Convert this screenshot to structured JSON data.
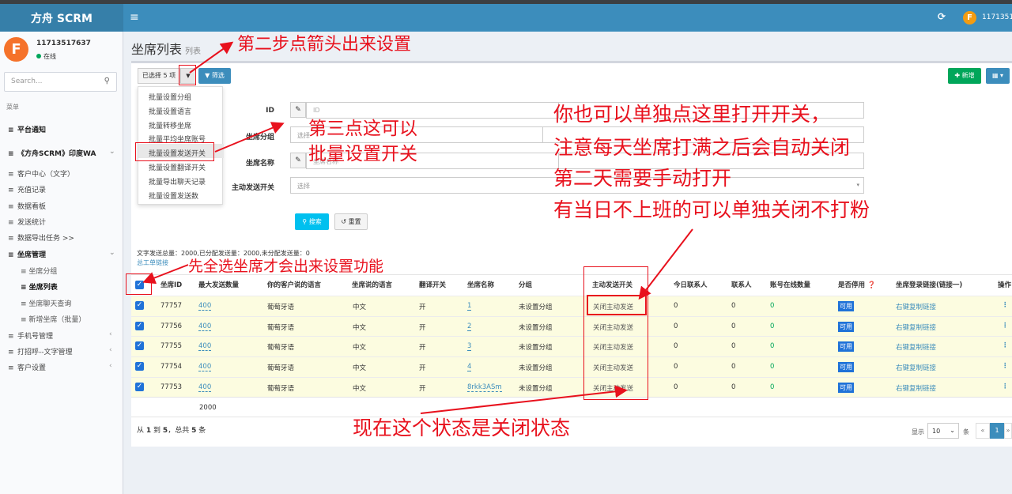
{
  "app": {
    "title": "方舟 SCRM",
    "menu_icon": "hamburger-icon",
    "refresh_icon": "refresh-icon",
    "user_avatar_letter": "F",
    "top_user": "11713517"
  },
  "user": {
    "name": "11713517637",
    "status": "在线",
    "avatar_letter": "F"
  },
  "sidebar": {
    "search_placeholder": "Search...",
    "menu_header": "菜单",
    "items": [
      {
        "label": "平台通知"
      },
      {
        "label": "《方舟SCRM》印度WA"
      },
      {
        "label": "客户中心（文字）"
      },
      {
        "label": "充值记录"
      },
      {
        "label": "数据看板"
      },
      {
        "label": "发送统计"
      },
      {
        "label": "数据导出任务 >>"
      },
      {
        "label": "坐席管理"
      },
      {
        "label": "手机号管理"
      },
      {
        "label": "打招呼--文字管理"
      },
      {
        "label": "客户设置"
      }
    ],
    "subitems": [
      {
        "label": "坐席分组"
      },
      {
        "label": "坐席列表"
      },
      {
        "label": "坐席聊天查询"
      },
      {
        "label": "新增坐席（批量）"
      }
    ]
  },
  "page": {
    "title": "坐席列表",
    "subtitle": "列表"
  },
  "toolbar": {
    "selected_label": "已选择 5 项",
    "filter_label": "筛选",
    "add_label": "新增"
  },
  "dropdown": {
    "items": [
      "批量设置分组",
      "批量设置语言",
      "批量转移坐席",
      "批量平均坐席账号",
      "批量设置发送开关",
      "批量设置翻译开关",
      "批量导出聊天记录",
      "批量设置发送数"
    ]
  },
  "form": {
    "id_label": "ID",
    "id_placeholder": "ID",
    "group_label": "坐席分组",
    "group_placeholder": "选择",
    "name_label": "坐席名称",
    "name_placeholder": "坐席名称",
    "switch_label": "主动发送开关",
    "switch_placeholder": "选择",
    "search_button": "搜索",
    "reset_button": "重置"
  },
  "summary": {
    "text": "文字发送总量：2000,已分配发送量：2000,未分配发送量：0",
    "link": "总工单链接"
  },
  "table": {
    "headers": [
      "坐席ID",
      "最大发送数量",
      "你的客户说的语言",
      "坐席说的语言",
      "翻译开关",
      "坐席名称",
      "分组",
      "主动发送开关",
      "今日联系人",
      "联系人",
      "账号在线数量",
      "是否停用",
      "坐席登录链接(链接一)",
      "操作"
    ],
    "rows": [
      {
        "id": "77757",
        "max": "400",
        "cust_lang": "葡萄牙语",
        "agent_lang": "中文",
        "translate": "开",
        "name": "1",
        "group": "未设置分组",
        "switch": "关闭主动发送",
        "today": "0",
        "contacts": "0",
        "online": "0",
        "status": "可用",
        "link": "右键复制链接"
      },
      {
        "id": "77756",
        "max": "400",
        "cust_lang": "葡萄牙语",
        "agent_lang": "中文",
        "translate": "开",
        "name": "2",
        "group": "未设置分组",
        "switch": "关闭主动发送",
        "today": "0",
        "contacts": "0",
        "online": "0",
        "status": "可用",
        "link": "右键复制链接"
      },
      {
        "id": "77755",
        "max": "400",
        "cust_lang": "葡萄牙语",
        "agent_lang": "中文",
        "translate": "开",
        "name": "3",
        "group": "未设置分组",
        "switch": "关闭主动发送",
        "today": "0",
        "contacts": "0",
        "online": "0",
        "status": "可用",
        "link": "右键复制链接"
      },
      {
        "id": "77754",
        "max": "400",
        "cust_lang": "葡萄牙语",
        "agent_lang": "中文",
        "translate": "开",
        "name": "4",
        "group": "未设置分组",
        "switch": "关闭主动发送",
        "today": "0",
        "contacts": "0",
        "online": "0",
        "status": "可用",
        "link": "右键复制链接"
      },
      {
        "id": "77753",
        "max": "400",
        "cust_lang": "葡萄牙语",
        "agent_lang": "中文",
        "translate": "开",
        "name": "8rkk3ASm",
        "group": "未设置分组",
        "switch": "关闭主动发送",
        "today": "0",
        "contacts": "0",
        "online": "0",
        "status": "可用",
        "link": "右键复制链接"
      }
    ],
    "total_max": "2000"
  },
  "pagination": {
    "info_prefix": "从",
    "from": "1",
    "to_word": "到",
    "to": "5",
    "total_word": "，总共",
    "total": "5",
    "unit": "条",
    "show_label": "显示",
    "page_size": "10",
    "per_label": "条",
    "prev": "«",
    "current": "1",
    "next": "»"
  },
  "annotations": {
    "step2": "第二步点箭头出来设置",
    "step3_line1": "第三点这可以",
    "step3_line2": "批量设置开关",
    "note_line1": "你也可以单独点这里打开开关，",
    "note_line2": "注意每天坐席打满之后会自动关闭",
    "note_line3": "第二天需要手动打开",
    "note_line4": "有当日不上班的可以单独关闭不打粉",
    "select_all": "先全选坐席才会出来设置功能",
    "status_note": "现在这个状态是关闭状态"
  },
  "colors": {
    "annotation": "#e8111d",
    "primary": "#3c8dbc",
    "success": "#00a65a"
  }
}
